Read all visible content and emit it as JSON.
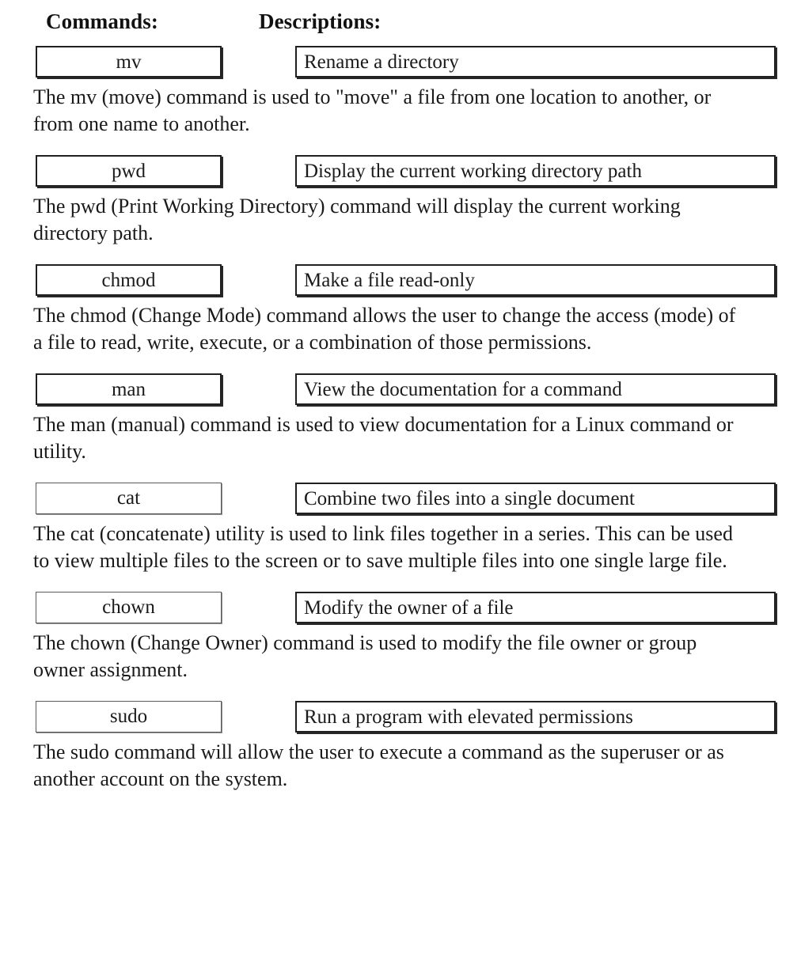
{
  "header": {
    "commands_label": "Commands:",
    "descriptions_label": "Descriptions:"
  },
  "entries": [
    {
      "command": "mv",
      "description": "Rename a directory",
      "explanation": "The mv (move) command is used to \"move\" a file from one location to another, or from one name to another.",
      "border_style": "heavy"
    },
    {
      "command": "pwd",
      "description": "Display the current working directory path",
      "explanation": "The pwd (Print Working Directory) command will display the current working directory path.",
      "border_style": "heavy"
    },
    {
      "command": "chmod",
      "description": "Make a file read-only",
      "explanation": "The chmod (Change Mode) command allows the user to change the access (mode) of a file to read, write, execute, or a combination of those permissions.",
      "border_style": "heavy"
    },
    {
      "command": "man",
      "description": "View the documentation for a command",
      "explanation": "The man (manual) command is used to view documentation for a Linux command or utility.",
      "border_style": "heavy"
    },
    {
      "command": "cat",
      "description": "Combine two files into a single document",
      "explanation": "The cat (concatenate) utility is used to link files together in a series. This can be used to view multiple files to the screen or to save multiple files into one single large file.",
      "border_style": "light"
    },
    {
      "command": "chown",
      "description": "Modify the owner of a file",
      "explanation": "The chown (Change Owner) command is used to modify the file owner or group owner assignment.",
      "border_style": "light"
    },
    {
      "command": "sudo",
      "description": "Run a program with elevated permissions",
      "explanation": "The sudo command will allow the user to execute a command as the superuser or as another account on the system.",
      "border_style": "light"
    }
  ],
  "colors": {
    "page_background": "#ffffff",
    "text": "#1a1a1a",
    "border_heavy": "#221f1f",
    "border_light": "#5a5a5a"
  }
}
